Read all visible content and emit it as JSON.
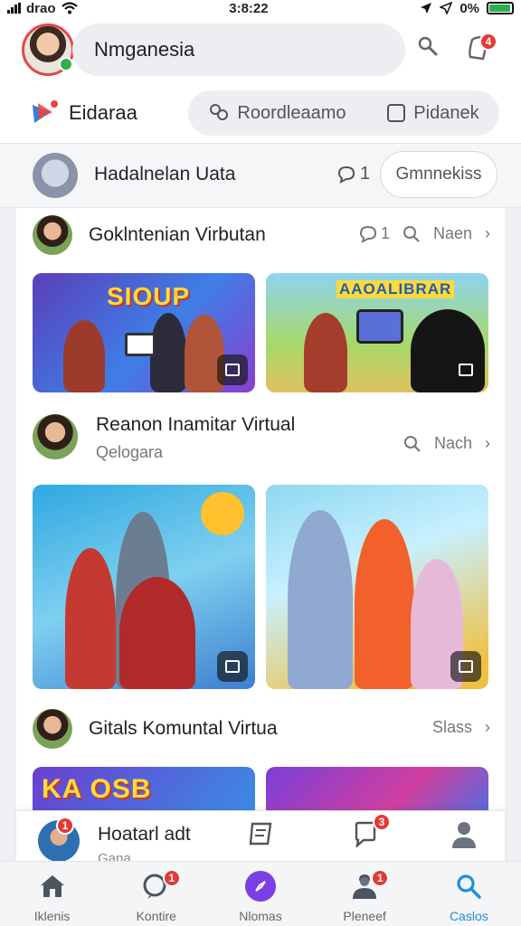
{
  "status": {
    "carrier": "drao",
    "time": "3:8:22",
    "battery": "0%",
    "battery_level": 0.95
  },
  "header": {
    "search_text": "Nmganesia",
    "search_icon": "search-icon",
    "notif_icon": "bell-icon",
    "notif_badge": "4",
    "brand_name": "Eidaraa",
    "segments": [
      {
        "label": "Roordleaamo",
        "icon": "people-icon"
      },
      {
        "label": "Pidanek",
        "icon": "square-icon"
      }
    ]
  },
  "group": {
    "title": "Hadalnelan Uata",
    "count": "1",
    "button": "Gmnnekiss"
  },
  "posts": [
    {
      "title": "Goklntenian Virbutan",
      "comments": "1",
      "action": "Naen",
      "thumbs": [
        "SIOUP",
        "AAOALIBRAR"
      ]
    },
    {
      "title": "Reanon Inamitar Virtual",
      "subtitle": "Qelogara",
      "action": "Nach",
      "thumbs": [
        "",
        ""
      ]
    },
    {
      "title": "Gitals Komuntal Virtua",
      "action": "Slass",
      "thumbs": [
        "KA OSB",
        ""
      ]
    }
  ],
  "composer": {
    "title": "Hoatarl adt",
    "subtitle": "Gana",
    "badge1": "1",
    "badge2": "3"
  },
  "tabs": [
    {
      "label": "Iklenis",
      "icon": "home-icon",
      "badge": ""
    },
    {
      "label": "Kontire",
      "icon": "chat-icon",
      "badge": "1"
    },
    {
      "label": "Nlomas",
      "icon": "compass-icon",
      "badge": ""
    },
    {
      "label": "Pleneef",
      "icon": "profile-group-icon",
      "badge": "1"
    },
    {
      "label": "Caslos",
      "icon": "search-icon",
      "badge": ""
    }
  ],
  "active_tab": "Caslos",
  "colors": {
    "accent": "#1e8fd6",
    "badge": "#e53935",
    "online": "#2bb24c",
    "center_tab": "#7b3fe4"
  }
}
